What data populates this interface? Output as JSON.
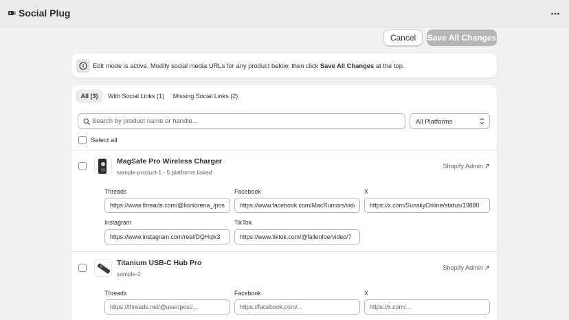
{
  "app": {
    "title": "Social Plug"
  },
  "actions": {
    "cancel_label": "Cancel",
    "save_label": "Save All Changes"
  },
  "banner": {
    "text_before": "Edit mode is active. Modify social media URLs for any product below, then click ",
    "text_bold": "Save All Changes",
    "text_after": " at the top."
  },
  "tabs": [
    {
      "label": "All (3)",
      "active": true
    },
    {
      "label": "With Social Links (1)",
      "active": false
    },
    {
      "label": "Missing Social Links (2)",
      "active": false
    }
  ],
  "search": {
    "placeholder": "Search by product name or handle..."
  },
  "platform_filter": {
    "value": "All Platforms"
  },
  "select_all": {
    "label": "Select all"
  },
  "products": [
    {
      "title": "MagSafe Pro Wireless Charger",
      "handle": "sample-product-1",
      "meta_sep": " · ",
      "linked": "5 platforms linked",
      "admin_link": "Shopify Admin",
      "fields": [
        {
          "label": "Threads",
          "value": "https://www.threads.com/@lionlorena_/post/",
          "placeholder": ""
        },
        {
          "label": "Facebook",
          "value": "https://www.facebook.com/MacRumors/videos/",
          "placeholder": ""
        },
        {
          "label": "X",
          "value": "https://x.com/SunskyOnline/status/19880",
          "placeholder": ""
        },
        {
          "label": "Instagram",
          "value": "https://www.instagram.com/reel/DQHqlx3",
          "placeholder": ""
        },
        {
          "label": "TikTok",
          "value": "https://www.tiktok.com/@fallenfoe/video/7",
          "placeholder": ""
        }
      ]
    },
    {
      "title": "Titanium USB-C Hub Pro",
      "handle": "sample-2",
      "admin_link": "Shopify Admin",
      "fields": [
        {
          "label": "Threads",
          "value": "",
          "placeholder": "https://threads.net/@user/post/..."
        },
        {
          "label": "Facebook",
          "value": "",
          "placeholder": "https://facebook.com/..."
        },
        {
          "label": "X",
          "value": "",
          "placeholder": "https://x.com/..."
        }
      ]
    }
  ],
  "icons": {
    "logo": "plug-icon",
    "more": "more-horizontal-icon",
    "info": "info-icon",
    "search": "search-icon",
    "select": "select-arrows-icon",
    "external": "external-link-icon"
  },
  "colors": {
    "save_disabled": "#b5b5b5",
    "page_bg": "#f1f1f1",
    "text": "#303030",
    "muted": "#616161"
  }
}
